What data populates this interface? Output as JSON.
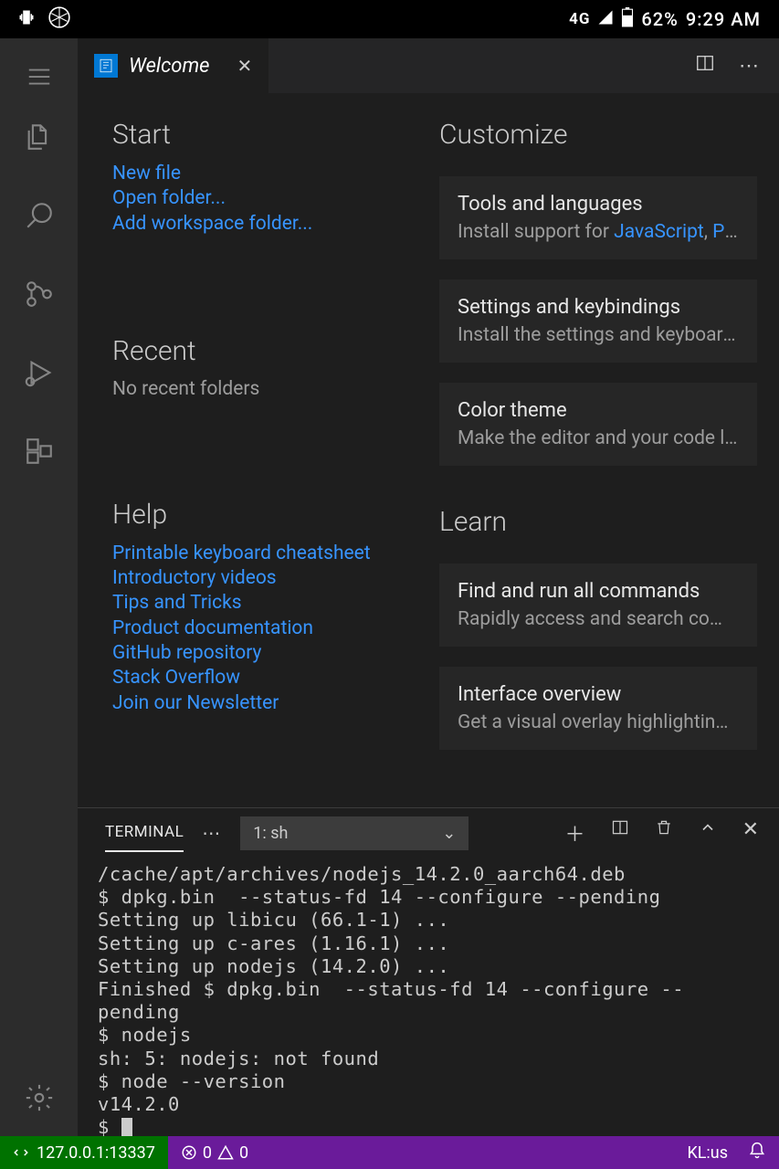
{
  "status_bar": {
    "network": "4G",
    "battery": "62%",
    "time": "9:29 AM"
  },
  "tab": {
    "title": "Welcome"
  },
  "welcome": {
    "start": {
      "heading": "Start",
      "links": [
        "New file",
        "Open folder...",
        "Add workspace folder..."
      ]
    },
    "recent": {
      "heading": "Recent",
      "empty": "No recent folders"
    },
    "help": {
      "heading": "Help",
      "links": [
        "Printable keyboard cheatsheet",
        "Introductory videos",
        "Tips and Tricks",
        "Product documentation",
        "GitHub repository",
        "Stack Overflow",
        "Join our Newsletter"
      ]
    },
    "customize": {
      "heading": "Customize",
      "cards": [
        {
          "title": "Tools and languages",
          "desc_pre": "Install support for ",
          "link1": "JavaScript",
          "sep": ", ",
          "link2": "Pyt…"
        },
        {
          "title": "Settings and keybindings",
          "desc": "Install the settings and keyboard s…"
        },
        {
          "title": "Color theme",
          "desc": "Make the editor and your code loo…"
        }
      ]
    },
    "learn": {
      "heading": "Learn",
      "cards": [
        {
          "title": "Find and run all commands",
          "desc": "Rapidly access and search comm…"
        },
        {
          "title": "Interface overview",
          "desc": "Get a visual overlay highlighting th…"
        }
      ]
    }
  },
  "terminal": {
    "tab_label": "TERMINAL",
    "select": "1: sh",
    "output": "/cache/apt/archives/nodejs_14.2.0_aarch64.deb\n$ dpkg.bin  --status-fd 14 --configure --pending\nSetting up libicu (66.1-1) ...\nSetting up c-ares (1.16.1) ...\nSetting up nodejs (14.2.0) ...\nFinished $ dpkg.bin  --status-fd 14 --configure --pending\n$ nodejs\nsh: 5: nodejs: not found\n$ node --version\nv14.2.0\n$ "
  },
  "bottom_bar": {
    "remote": "127.0.0.1:13337",
    "errors": "0",
    "warnings": "0",
    "keyboard": "KL:us"
  }
}
